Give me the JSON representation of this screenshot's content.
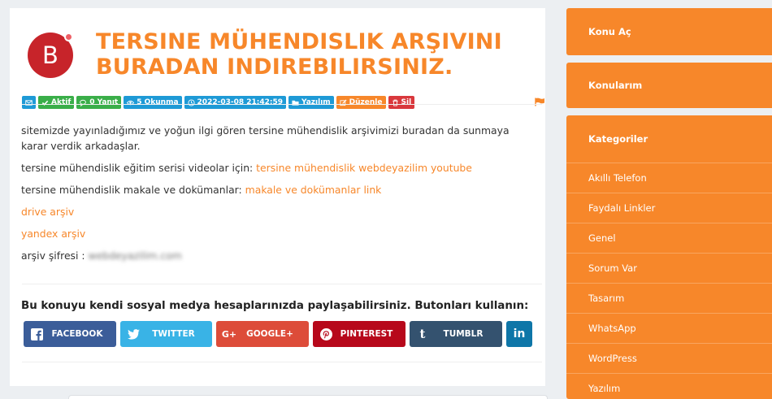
{
  "post": {
    "avatar_letter": "B",
    "title": "TERSINE MÜHENDISLIK ARŞIVINI BURADAN INDIREBILIRSINIZ.",
    "badges": {
      "status": "Aktif",
      "replies": "0 Yanıt",
      "reads": "5 Okunma",
      "datetime": "2022-03-08 21:42:59",
      "category": "Yazılım",
      "edit": "Düzenle",
      "delete": "Sil"
    },
    "body": {
      "intro": "sitemizde yayınladığımız ve yoğun ilgi gören tersine mühendislik arşivimizi buradan da sunmaya karar verdik arkadaşlar.",
      "video_prefix": "tersine mühendislik eğitim serisi videolar için: ",
      "video_link": "tersine mühendislik webdeyazilim youtube",
      "docs_prefix": "tersine mühendislik makale ve dokümanlar: ",
      "docs_link": "makale ve dokümanlar link",
      "drive_link": "drive arşiv",
      "yandex_link": "yandex arşiv",
      "password_label": "arşiv şifresi : ",
      "password_value": "webdeyazilim.com"
    }
  },
  "share": {
    "title": "Bu konuyu kendi sosyal medya hesaplarınızda paylaşabilirsiniz. Butonları kullanın:",
    "facebook": "FACEBOOK",
    "twitter": "TWITTER",
    "googleplus": "GOOGLE+",
    "pinterest": "PINTEREST",
    "tumblr": "TUMBLR",
    "linkedin": "in"
  },
  "sidebar": {
    "open_topic": "Konu Aç",
    "my_topics": "Konularım",
    "categories_title": "Kategoriler",
    "categories": [
      "Akıllı Telefon",
      "Faydalı Linkler",
      "Genel",
      "Sorum Var",
      "Tasarım",
      "WhatsApp",
      "WordPress",
      "Yazılım"
    ]
  },
  "colors": {
    "accent": "#f7872a",
    "avatar": "#c7242a"
  }
}
